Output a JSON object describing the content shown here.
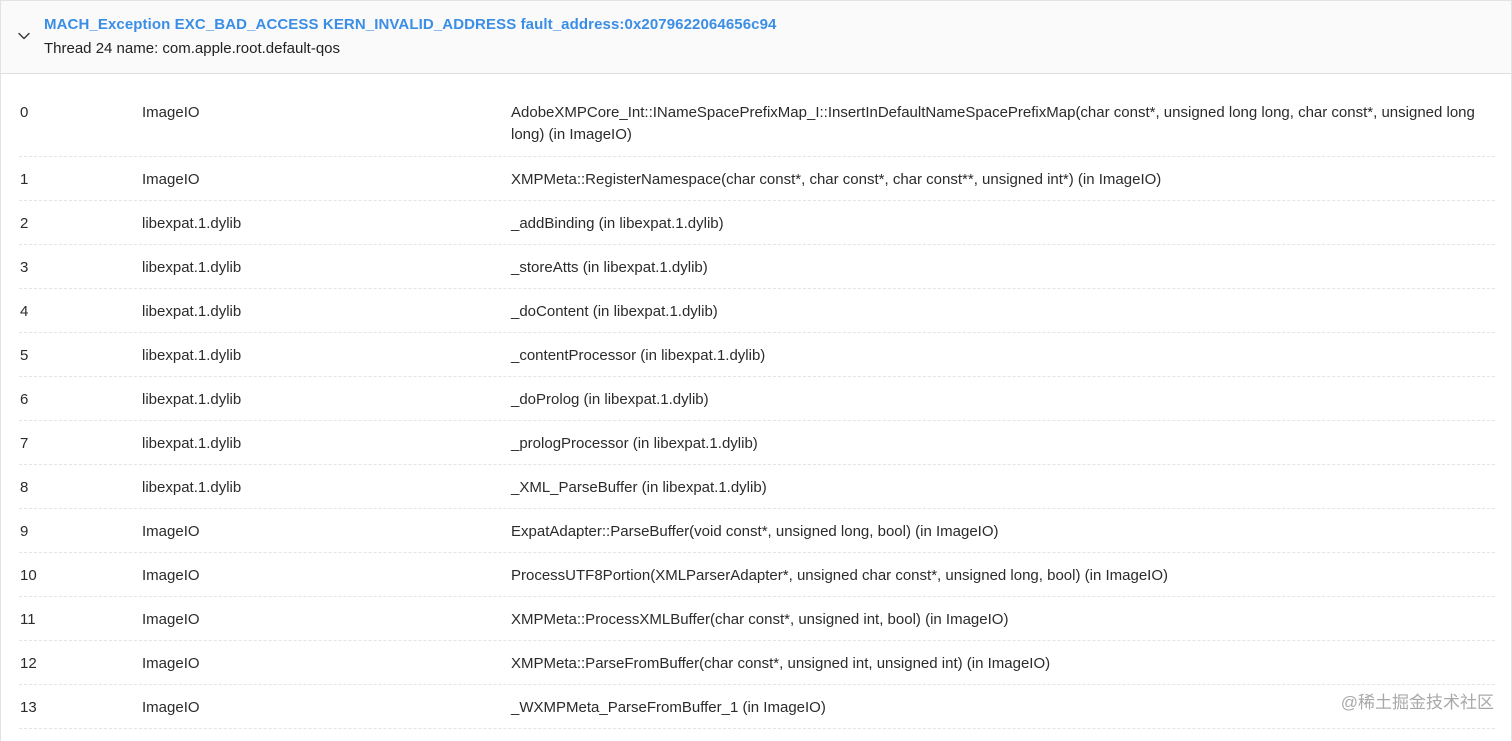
{
  "header": {
    "title": "MACH_Exception EXC_BAD_ACCESS KERN_INVALID_ADDRESS fault_address:0x2079622064656c94",
    "subtitle": "Thread 24 name: com.apple.root.default-qos",
    "toggle_icon": "chevron-down-icon"
  },
  "frames": [
    {
      "index": "0",
      "library": "ImageIO",
      "symbol": "AdobeXMPCore_Int::INameSpacePrefixMap_I::InsertInDefaultNameSpacePrefixMap(char const*, unsigned long long, char const*, unsigned long long) (in ImageIO)"
    },
    {
      "index": "1",
      "library": "ImageIO",
      "symbol": "XMPMeta::RegisterNamespace(char const*, char const*, char const**, unsigned int*) (in ImageIO)"
    },
    {
      "index": "2",
      "library": "libexpat.1.dylib",
      "symbol": "_addBinding (in libexpat.1.dylib)"
    },
    {
      "index": "3",
      "library": "libexpat.1.dylib",
      "symbol": "_storeAtts (in libexpat.1.dylib)"
    },
    {
      "index": "4",
      "library": "libexpat.1.dylib",
      "symbol": "_doContent (in libexpat.1.dylib)"
    },
    {
      "index": "5",
      "library": "libexpat.1.dylib",
      "symbol": "_contentProcessor (in libexpat.1.dylib)"
    },
    {
      "index": "6",
      "library": "libexpat.1.dylib",
      "symbol": "_doProlog (in libexpat.1.dylib)"
    },
    {
      "index": "7",
      "library": "libexpat.1.dylib",
      "symbol": "_prologProcessor (in libexpat.1.dylib)"
    },
    {
      "index": "8",
      "library": "libexpat.1.dylib",
      "symbol": "_XML_ParseBuffer (in libexpat.1.dylib)"
    },
    {
      "index": "9",
      "library": "ImageIO",
      "symbol": "ExpatAdapter::ParseBuffer(void const*, unsigned long, bool) (in ImageIO)"
    },
    {
      "index": "10",
      "library": "ImageIO",
      "symbol": "ProcessUTF8Portion(XMLParserAdapter*, unsigned char const*, unsigned long, bool) (in ImageIO)"
    },
    {
      "index": "11",
      "library": "ImageIO",
      "symbol": "XMPMeta::ProcessXMLBuffer(char const*, unsigned int, bool) (in ImageIO)"
    },
    {
      "index": "12",
      "library": "ImageIO",
      "symbol": "XMPMeta::ParseFromBuffer(char const*, unsigned int, unsigned int) (in ImageIO)"
    },
    {
      "index": "13",
      "library": "ImageIO",
      "symbol": "_WXMPMeta_ParseFromBuffer_1 (in ImageIO)"
    }
  ],
  "watermark": "@稀土掘金技术社区",
  "colors": {
    "title": "#3a8ee6",
    "header_bg": "#fafafa",
    "text": "#2b2b2b"
  }
}
